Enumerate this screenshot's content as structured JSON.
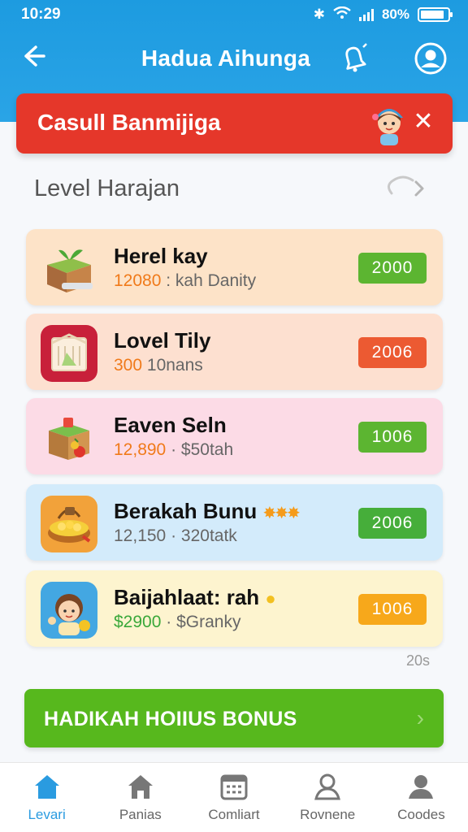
{
  "status_bar": {
    "time": "10:29",
    "battery": "80%"
  },
  "app_bar": {
    "title": "Hadua Aihunga"
  },
  "banner": {
    "text": "Casull Banmijiga"
  },
  "section": {
    "title": "Level Harajan"
  },
  "items": [
    {
      "name": "Herel kay",
      "value": "12080",
      "sep": " : ",
      "detail": "kah Danity",
      "price": "2000",
      "chip_color": "#5cb531",
      "bg": "#fde3c8"
    },
    {
      "name": "Lovel Tily",
      "value": "300",
      "sep": " ",
      "detail": "10nans",
      "price": "2006",
      "chip_color": "#ec5a32",
      "bg": "#fde0d0"
    },
    {
      "name": "Eaven Seln",
      "value": "12,890",
      "sep": " · ",
      "detail": "$50tah",
      "price": "1006",
      "chip_color": "#5cb531",
      "bg": "#fcdbe6"
    },
    {
      "name": "Berakah Bunu",
      "value": "12,150",
      "sep": " · ",
      "detail": "320tatk",
      "price": "2006",
      "chip_color": "#46ae3a",
      "bg": "#d3ebfb"
    },
    {
      "name": "Baijahlaat: rah",
      "value": "$2900",
      "sep": " · ",
      "detail": "$Granky",
      "price": "1006",
      "chip_color": "#f7a81b",
      "bg": "#fdf4cf"
    }
  ],
  "footnote": "20s",
  "bonus": {
    "label": "HADIKAH HOIIUS BONUS"
  },
  "nav": [
    {
      "label": "Levari",
      "icon": "home-icon",
      "active": true
    },
    {
      "label": "Panias",
      "icon": "house-icon",
      "active": false
    },
    {
      "label": "Comliart",
      "icon": "calendar-icon",
      "active": false
    },
    {
      "label": "Rovnene",
      "icon": "person-icon",
      "active": false
    },
    {
      "label": "Coodes",
      "icon": "user-icon",
      "active": false
    }
  ],
  "colors": {
    "primary": "#2aa4e6",
    "banner": "#e5372a",
    "bonus": "#57b81d",
    "accent_value": "#f07a1a"
  }
}
